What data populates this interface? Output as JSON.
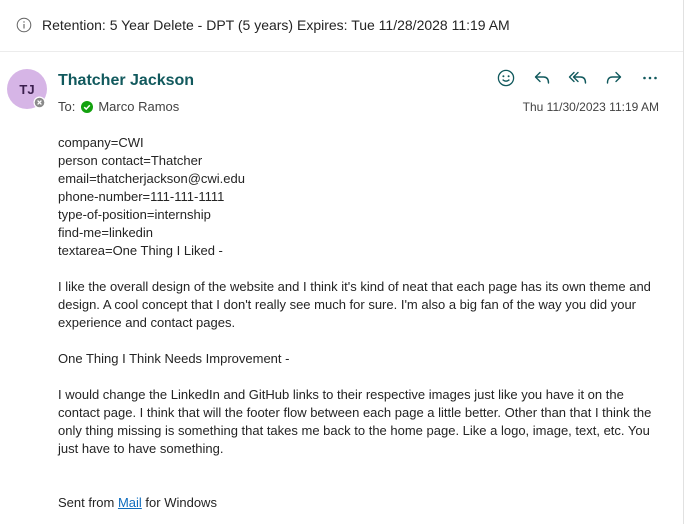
{
  "retention": {
    "icon": "info-icon",
    "text": "Retention: 5 Year Delete - DPT (5 years) Expires: Tue 11/28/2028 11:19 AM"
  },
  "sender": {
    "initials": "TJ",
    "name": "Thatcher Jackson",
    "avatar_color": "#d6b5e6",
    "presence": "offline"
  },
  "to": {
    "label": "To:",
    "recipient": "Marco Ramos",
    "status": "available",
    "status_color": "#13a10e"
  },
  "timestamp": "Thu 11/30/2023 11:19 AM",
  "actions": [
    {
      "name": "emoji-reaction",
      "icon": "smiley-icon"
    },
    {
      "name": "reply",
      "icon": "reply-icon"
    },
    {
      "name": "reply-all",
      "icon": "reply-all-icon"
    },
    {
      "name": "forward",
      "icon": "forward-icon"
    },
    {
      "name": "more-actions",
      "icon": "more-icon"
    }
  ],
  "body": {
    "fields": [
      "company=CWI",
      "person contact=Thatcher",
      "email=thatcherjackson@cwi.edu",
      "phone-number=111-111-1111",
      "type-of-position=internship",
      "find-me=linkedin",
      "textarea=One Thing I Liked -"
    ],
    "paragraph1": "I like the overall design of the website and I think it's kind of neat that each page has its own theme and design. A cool concept that I don't really see much for sure. I'm also a big fan of the way you did your experience and contact pages.",
    "heading2": "One Thing I Think Needs Improvement -",
    "paragraph2": "I would change the LinkedIn and GitHub links to their respective images just like you have it on the contact page. I think that will the footer flow between each page a little better. Other than that I think the only thing missing is something that takes me back to the home page. Like a logo, image, text, etc. You just have to have something.",
    "signature": {
      "prefix": "Sent from ",
      "link": "Mail",
      "suffix": " for Windows"
    }
  },
  "colors": {
    "accent": "#0f6cbd",
    "sender_name": "#11595d"
  }
}
